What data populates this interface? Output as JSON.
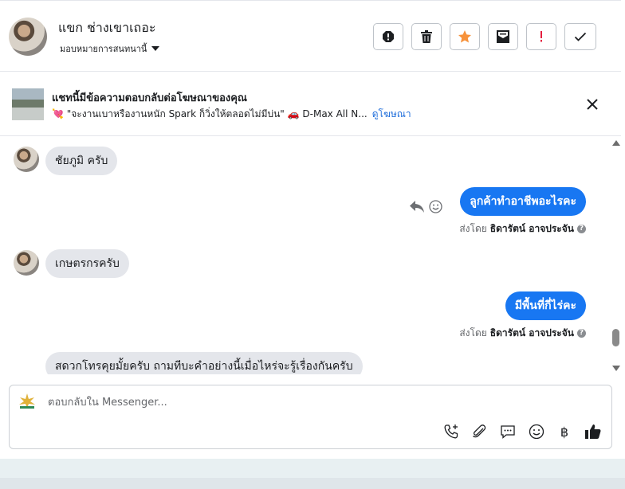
{
  "header": {
    "contact_name": "แขก ช่างเขาเถอะ",
    "assign_label": "มอบหมายการสนทนานี้",
    "tools": [
      "spam-icon",
      "trash-icon",
      "star-icon",
      "mark-unread-icon",
      "follow-up-icon",
      "done-icon"
    ],
    "colors": {
      "star": "#f7923b",
      "follow_up": "#e41e3f"
    }
  },
  "ad": {
    "title": "แชทนี้มีข้อความตอบกลับต่อโฆษณาของคุณ",
    "line": "💘 \"จะงานเบาหรืองานหนัก Spark ก็วิ่งให้ตลอดไม่มีบ่น\" 🚗 D-Max All N...",
    "link": "ดูโฆษณา"
  },
  "messages": [
    {
      "direction": "in",
      "text": "ชัยภูมิ ครับ"
    },
    {
      "direction": "out",
      "text": "ลูกค้าทำอาชีพอะไรคะ",
      "sent_by_label": "ส่งโดย",
      "sent_by_name": "ธิดารัตน์ อาจประจัน"
    },
    {
      "direction": "in",
      "text": "เกษตรกรครับ"
    },
    {
      "direction": "out",
      "text": "มีพื้นที่กี่ไร่คะ",
      "sent_by_label": "ส่งโดย",
      "sent_by_name": "ธิดารัตน์ อาจประจัน"
    },
    {
      "direction": "in",
      "text": "สดวกโทรคุยมั้ยครับ ถามทีบะคำอย่างนี้เมื่อไหร่จะรู้เรื่องกันครับ"
    }
  ],
  "composer": {
    "placeholder": "ตอบกลับใน Messenger...",
    "icons": [
      "add-call-icon",
      "attach-icon",
      "saved-reply-icon",
      "emoji-icon",
      "payment-icon",
      "like-icon"
    ]
  },
  "colors": {
    "accent": "#1877f2",
    "link": "#216fdb",
    "incoming_bubble": "#e4e6eb"
  }
}
